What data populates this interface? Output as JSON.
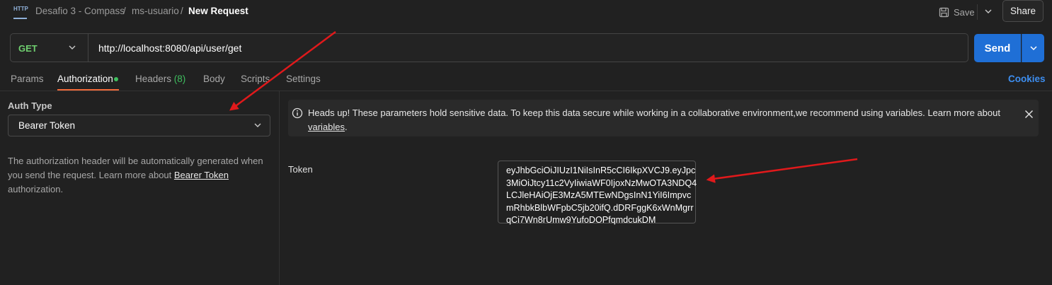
{
  "breadcrumb": {
    "collection": "Desafio 3 - Compass",
    "sep1": "/",
    "folder": "ms-usuario",
    "sep2": "/",
    "request": "New Request"
  },
  "header": {
    "icon_label": "HTTP",
    "save_label": "Save",
    "share_label": "Share"
  },
  "request": {
    "method": "GET",
    "url": "http://localhost:8080/api/user/get",
    "send_label": "Send"
  },
  "tabs": [
    {
      "label": "Params"
    },
    {
      "label": "Authorization"
    },
    {
      "label": "Headers",
      "count": "(8)"
    },
    {
      "label": "Body"
    },
    {
      "label": "Scripts"
    },
    {
      "label": "Settings"
    }
  ],
  "cookies_label": "Cookies",
  "auth": {
    "type_label": "Auth Type",
    "type_value": "Bearer Token",
    "desc_before": "The authorization header will be automatically generated when you send the request. Learn more about ",
    "desc_link": "Bearer Token",
    "desc_after": " authorization."
  },
  "notice": {
    "text": "Heads up! These parameters hold sensitive data. To keep this data secure while working in a collaborative environment,we recommend using variables. Learn more about ",
    "link": "variables",
    "end": "."
  },
  "token": {
    "label": "Token",
    "value": "eyJhbGciOiJIUzI1NiIsInR5cCI6IkpXVCJ9.eyJpc3MiOiJtcy11c2VyIiwiaWF0IjoxNzMwOTA3NDQ4LCJleHAiOjE3MzA5MTEwNDgsInN1YiI6ImpvcmRhbkBlbWFpbC5jb20ifQ.dDRFggK6xWnMgrrqCi7Wn8rUmw9YufoDOPfqmdcukDM"
  },
  "colors": {
    "accent": "#1f6fd6",
    "tab_indicator": "#f26b3a",
    "method_get": "#6fcf6f",
    "success_green": "#3fbf5f",
    "link_blue": "#3d8ef0",
    "annotation_arrow": "#e0191b"
  },
  "icons": [
    "http-icon",
    "save-icon",
    "chevron-down-icon",
    "info-icon",
    "close-icon"
  ]
}
